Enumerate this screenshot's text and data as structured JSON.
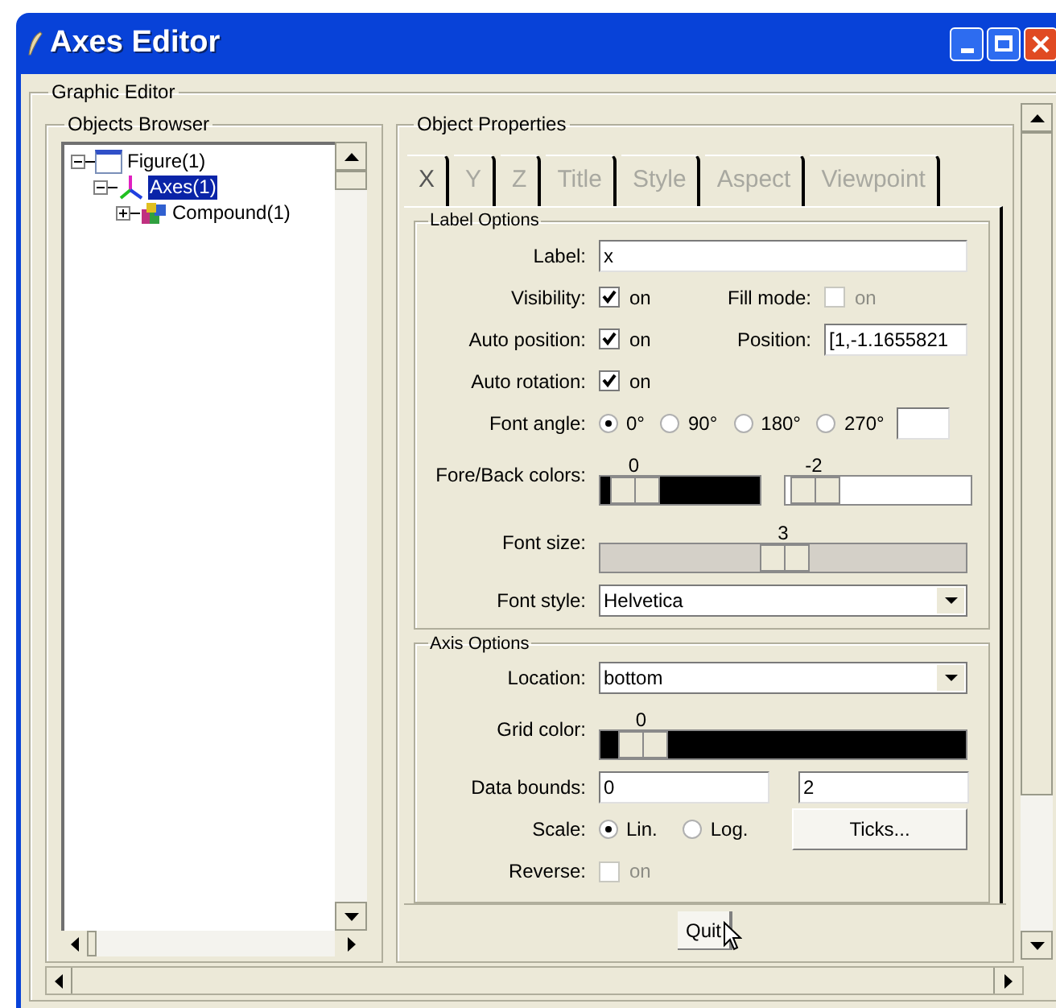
{
  "window": {
    "title": "Axes Editor"
  },
  "graphic_editor": {
    "title": "Graphic Editor"
  },
  "objects_browser": {
    "title": "Objects Browser",
    "tree": [
      {
        "label": "Figure(1)",
        "kind": "figure",
        "expanded": true,
        "selected": false,
        "children": [
          {
            "label": "Axes(1)",
            "kind": "axes",
            "expanded": true,
            "selected": true,
            "children": [
              {
                "label": "Compound(1)",
                "kind": "compound",
                "expanded": false,
                "selected": false
              }
            ]
          }
        ]
      }
    ]
  },
  "object_properties": {
    "title": "Object Properties",
    "tabs": [
      {
        "label": "X",
        "selected": true
      },
      {
        "label": "Y",
        "selected": false
      },
      {
        "label": "Z",
        "selected": false
      },
      {
        "label": "Title",
        "selected": false
      },
      {
        "label": "Style",
        "selected": false
      },
      {
        "label": "Aspect",
        "selected": false
      },
      {
        "label": "Viewpoint",
        "selected": false
      }
    ],
    "label_options": {
      "title": "Label Options",
      "rows": [
        {
          "kind": "text",
          "label": "Label:",
          "value": "x"
        },
        {
          "kind": "checkbox",
          "label": "Visibility:",
          "text": "on",
          "checked": true,
          "disabled": false,
          "right": {
            "kind": "checkbox",
            "label": "Fill mode:",
            "text": "on",
            "checked": false,
            "disabled": true
          }
        },
        {
          "kind": "checkbox",
          "label": "Auto position:",
          "text": "on",
          "checked": true,
          "disabled": false,
          "right": {
            "kind": "text",
            "label": "Position:",
            "value": "[1,-1.1655821"
          }
        },
        {
          "kind": "checkbox",
          "label": "Auto rotation:",
          "text": "on",
          "checked": true,
          "disabled": false
        },
        {
          "kind": "angle",
          "label": "Font angle:",
          "options": [
            {
              "label": "0°",
              "selected": true
            },
            {
              "label": "90°",
              "selected": false
            },
            {
              "label": "180°",
              "selected": false
            },
            {
              "label": "270°",
              "selected": false
            }
          ]
        },
        {
          "kind": "slider_pair",
          "label": "Fore/Back colors:",
          "sliders": [
            {
              "reading": "0",
              "level": 0.05,
              "color": "#000000"
            },
            {
              "reading": "-2",
              "level": 0,
              "color": "#ffffff"
            }
          ]
        },
        {
          "kind": "slider",
          "label": "Font size:",
          "reading": "3",
          "level": 0.5,
          "color": "#d4d0c8"
        },
        {
          "kind": "select",
          "label": "Font style:",
          "value": "Helvetica"
        }
      ]
    },
    "axis_options": {
      "title": "Axis Options",
      "rows": [
        {
          "kind": "select",
          "label": "Location:",
          "value": "bottom"
        },
        {
          "kind": "slider",
          "label": "Grid color:",
          "reading": "0",
          "level": 0.04,
          "color": "#000000"
        },
        {
          "kind": "bounds",
          "label": "Data bounds:",
          "values": [
            "0",
            "2"
          ]
        },
        {
          "kind": "radios",
          "label": "Scale:",
          "options": [
            {
              "label": "Lin.",
              "selected": true
            },
            {
              "label": "Log.",
              "selected": false
            }
          ],
          "right": {
            "kind": "button",
            "label": "Ticks..."
          }
        },
        {
          "kind": "checkbox",
          "label": "Reverse:",
          "text": "on",
          "checked": false,
          "disabled": true
        }
      ]
    },
    "quit_button": "Quit"
  }
}
